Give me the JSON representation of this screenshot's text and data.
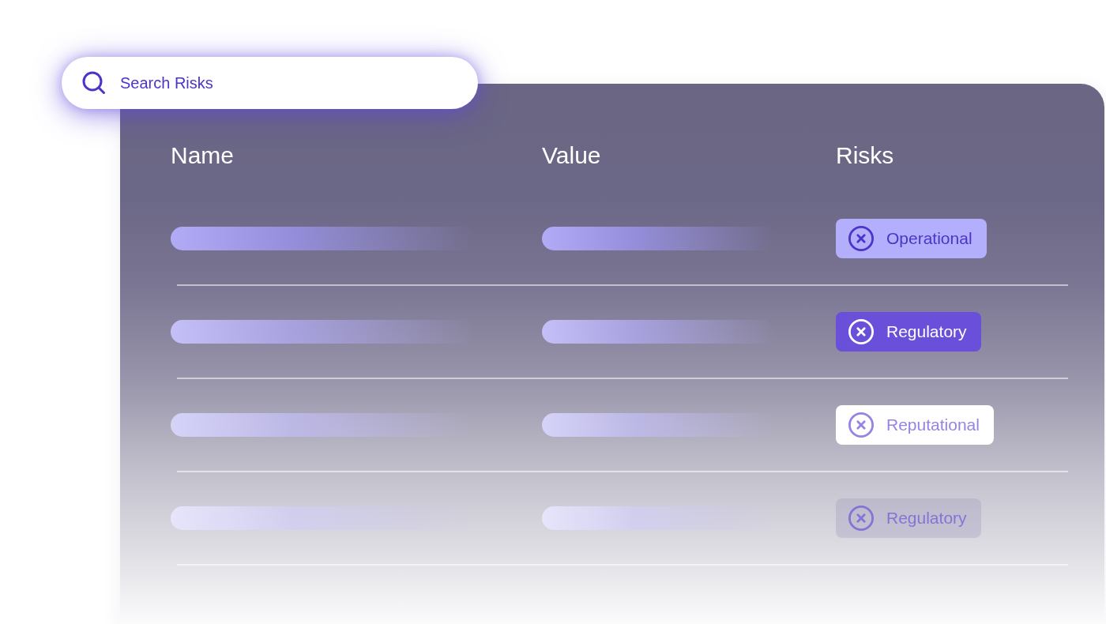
{
  "search": {
    "placeholder": "Search Risks"
  },
  "table": {
    "columns": [
      "Name",
      "Value",
      "Risks"
    ],
    "rows": [
      {
        "risk": {
          "label": "Operational",
          "kind": "tint"
        }
      },
      {
        "risk": {
          "label": "Regulatory",
          "kind": "solid"
        }
      },
      {
        "risk": {
          "label": "Reputational",
          "kind": "plain"
        }
      },
      {
        "risk": {
          "label": "Regulatory",
          "kind": "muted"
        }
      }
    ]
  }
}
